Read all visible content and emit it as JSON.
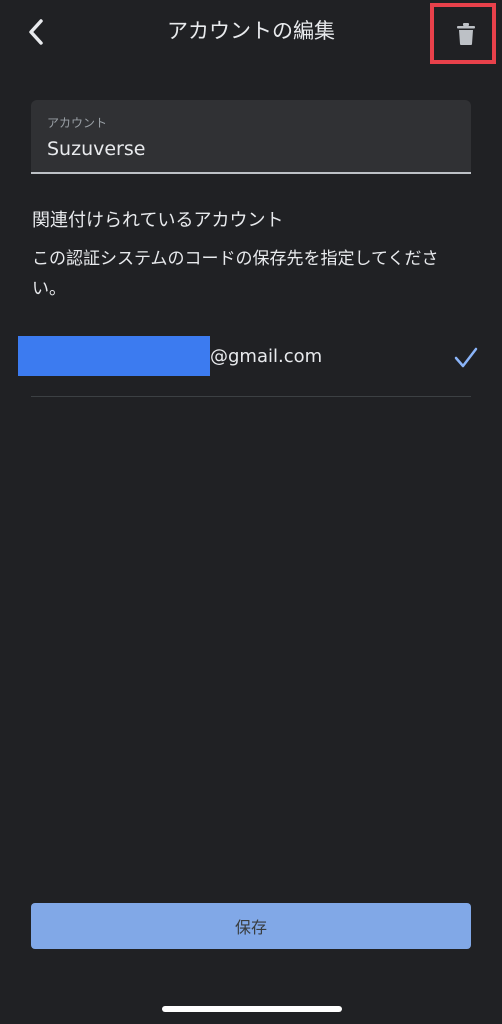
{
  "header": {
    "title": "アカウントの編集",
    "back_icon": "chevron-left-icon",
    "delete_icon": "trash-icon",
    "highlight_color": "#e8414b"
  },
  "account_field": {
    "label": "アカウント",
    "value": "Suzuverse"
  },
  "linked_section": {
    "heading": "関連付けられているアカウント",
    "description": "この認証システムのコードの保存先を指定してください。"
  },
  "accounts": [
    {
      "email_suffix": "@gmail.com",
      "selected": true,
      "redaction_color": "#3c7bf0"
    }
  ],
  "footer": {
    "save_label": "保存",
    "accent_color": "#8ab4f8"
  }
}
